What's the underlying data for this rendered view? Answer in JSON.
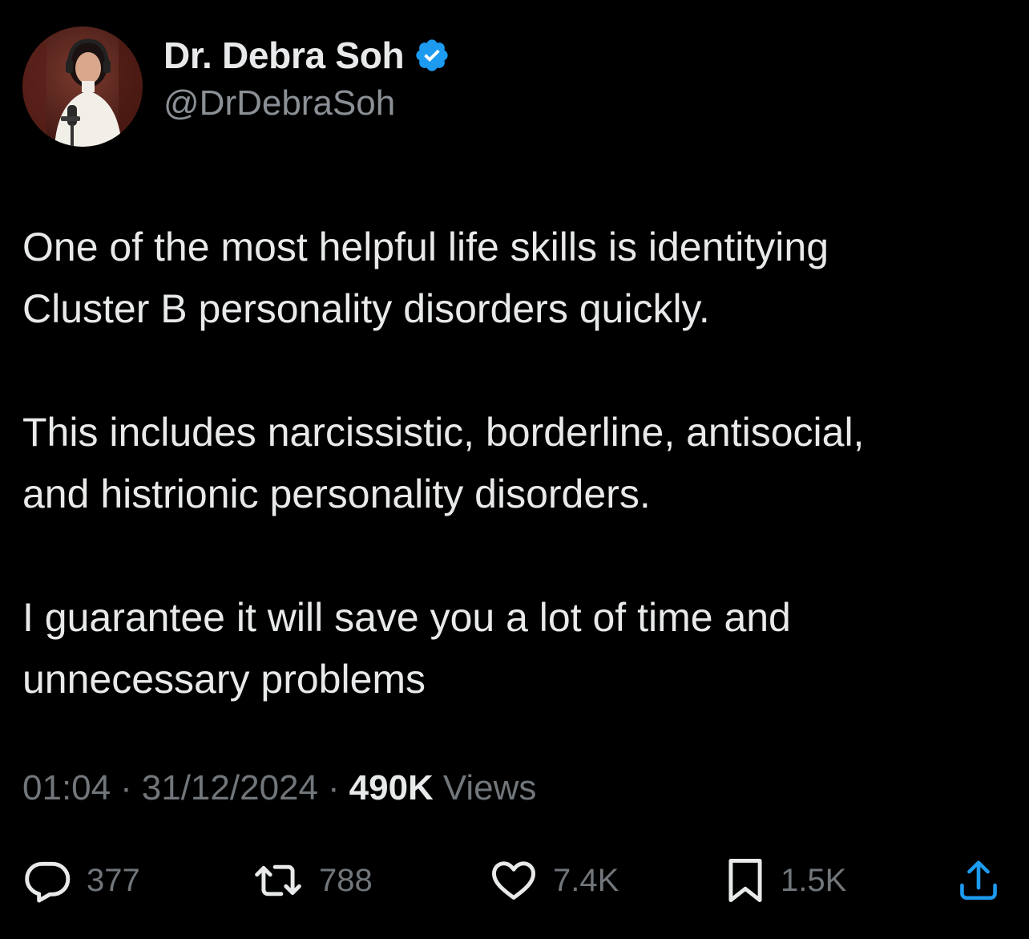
{
  "author": {
    "display_name": "Dr. Debra Soh",
    "handle": "@DrDebraSoh",
    "verified": true,
    "verified_color": "#1d9bf0"
  },
  "tweet": {
    "paragraphs": [
      [
        "One of the most helpful life skills is identitying",
        "Cluster B personality disorders quickly."
      ],
      [
        "This includes narcissistic, borderline, antisocial,",
        "and histrionic personality disorders."
      ],
      [
        "I guarantee it will save you a lot of time and",
        "unnecessary problems"
      ]
    ]
  },
  "meta": {
    "time": "01:04",
    "separator": "·",
    "date": "31/12/2024",
    "views_count": "490K",
    "views_label": "Views"
  },
  "actions": {
    "replies": "377",
    "retweets": "788",
    "likes": "7.4K",
    "bookmarks": "1.5K"
  },
  "icons": {
    "reply": "reply-icon",
    "retweet": "retweet-icon",
    "like": "heart-icon",
    "bookmark": "bookmark-icon",
    "share": "share-icon",
    "verified": "verified-badge-icon"
  },
  "colors": {
    "background": "#000000",
    "text_primary": "#e7e9ea",
    "text_secondary": "#71767b"
  }
}
